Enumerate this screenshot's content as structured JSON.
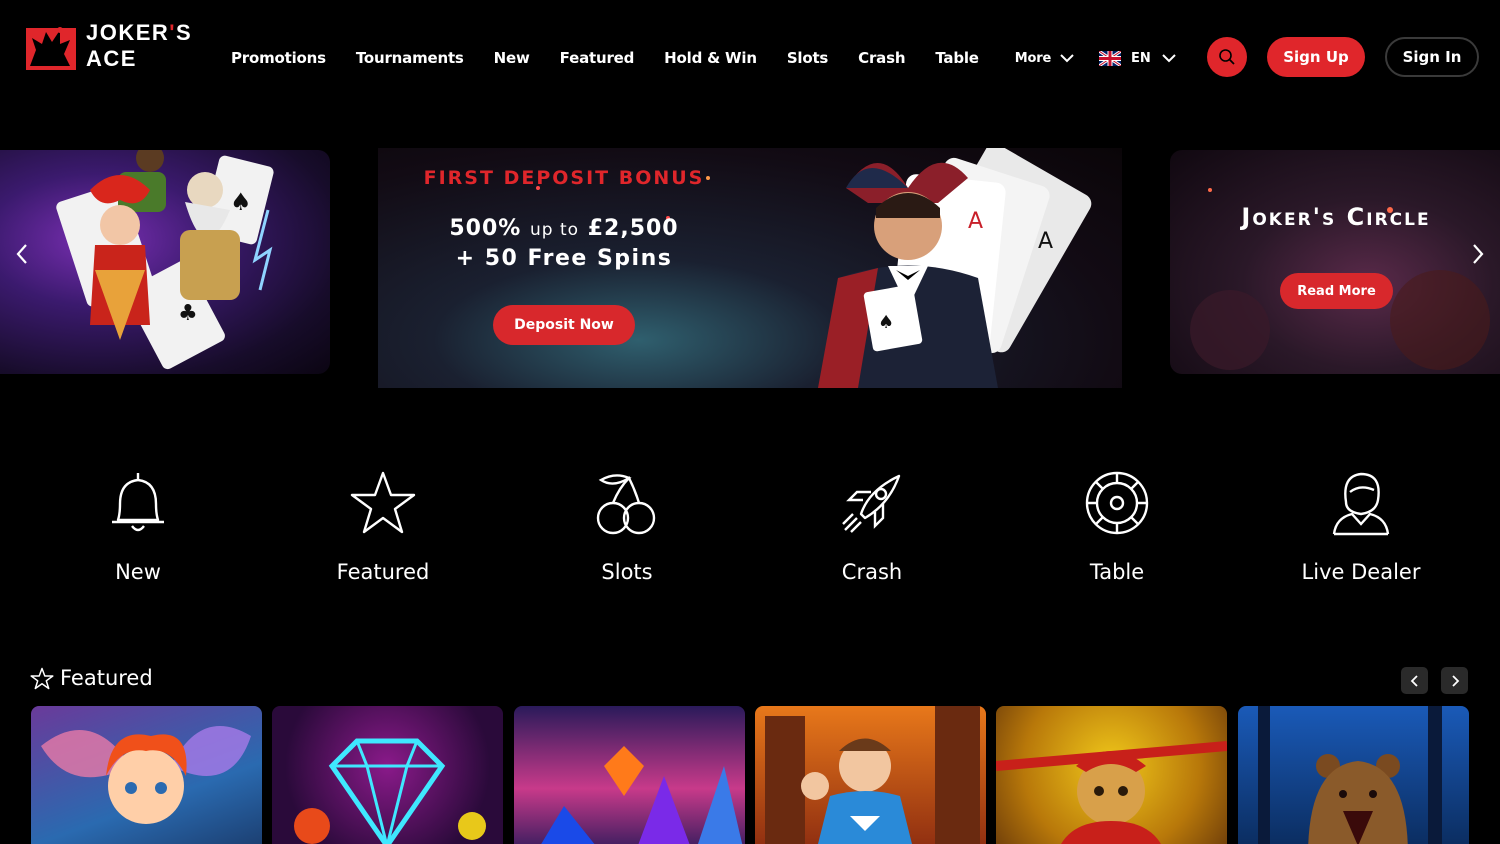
{
  "brand": {
    "name_line1": "JOKER",
    "name_apos": "'",
    "name_s": "S",
    "name_line2": "ACE"
  },
  "nav": [
    {
      "label": "Promotions"
    },
    {
      "label": "Tournaments"
    },
    {
      "label": "New"
    },
    {
      "label": "Featured"
    },
    {
      "label": "Hold & Win"
    },
    {
      "label": "Slots"
    },
    {
      "label": "Crash"
    },
    {
      "label": "Table"
    }
  ],
  "nav_more": "More",
  "language": {
    "code": "EN",
    "flag_icon": "uk-flag-icon"
  },
  "header_buttons": {
    "signup": "Sign Up",
    "signin": "Sign In"
  },
  "hero": {
    "main": {
      "title": "First Deposit Bonus",
      "amount_big1": "500%",
      "amount_small": "up to",
      "amount_big2": "£2,500",
      "spins": "+ 50 Free Spins",
      "cta": "Deposit Now"
    },
    "right": {
      "title": "Joker's Circle",
      "cta": "Read More"
    }
  },
  "categories": [
    {
      "label": "New",
      "icon": "bell-icon"
    },
    {
      "label": "Featured",
      "icon": "star-icon"
    },
    {
      "label": "Slots",
      "icon": "cherries-icon"
    },
    {
      "label": "Crash",
      "icon": "rocket-icon"
    },
    {
      "label": "Table",
      "icon": "roulette-icon"
    },
    {
      "label": "Live Dealer",
      "icon": "dealer-icon"
    }
  ],
  "featured": {
    "title": "Featured"
  },
  "colors": {
    "accent": "#e0262b",
    "background": "#000000"
  }
}
